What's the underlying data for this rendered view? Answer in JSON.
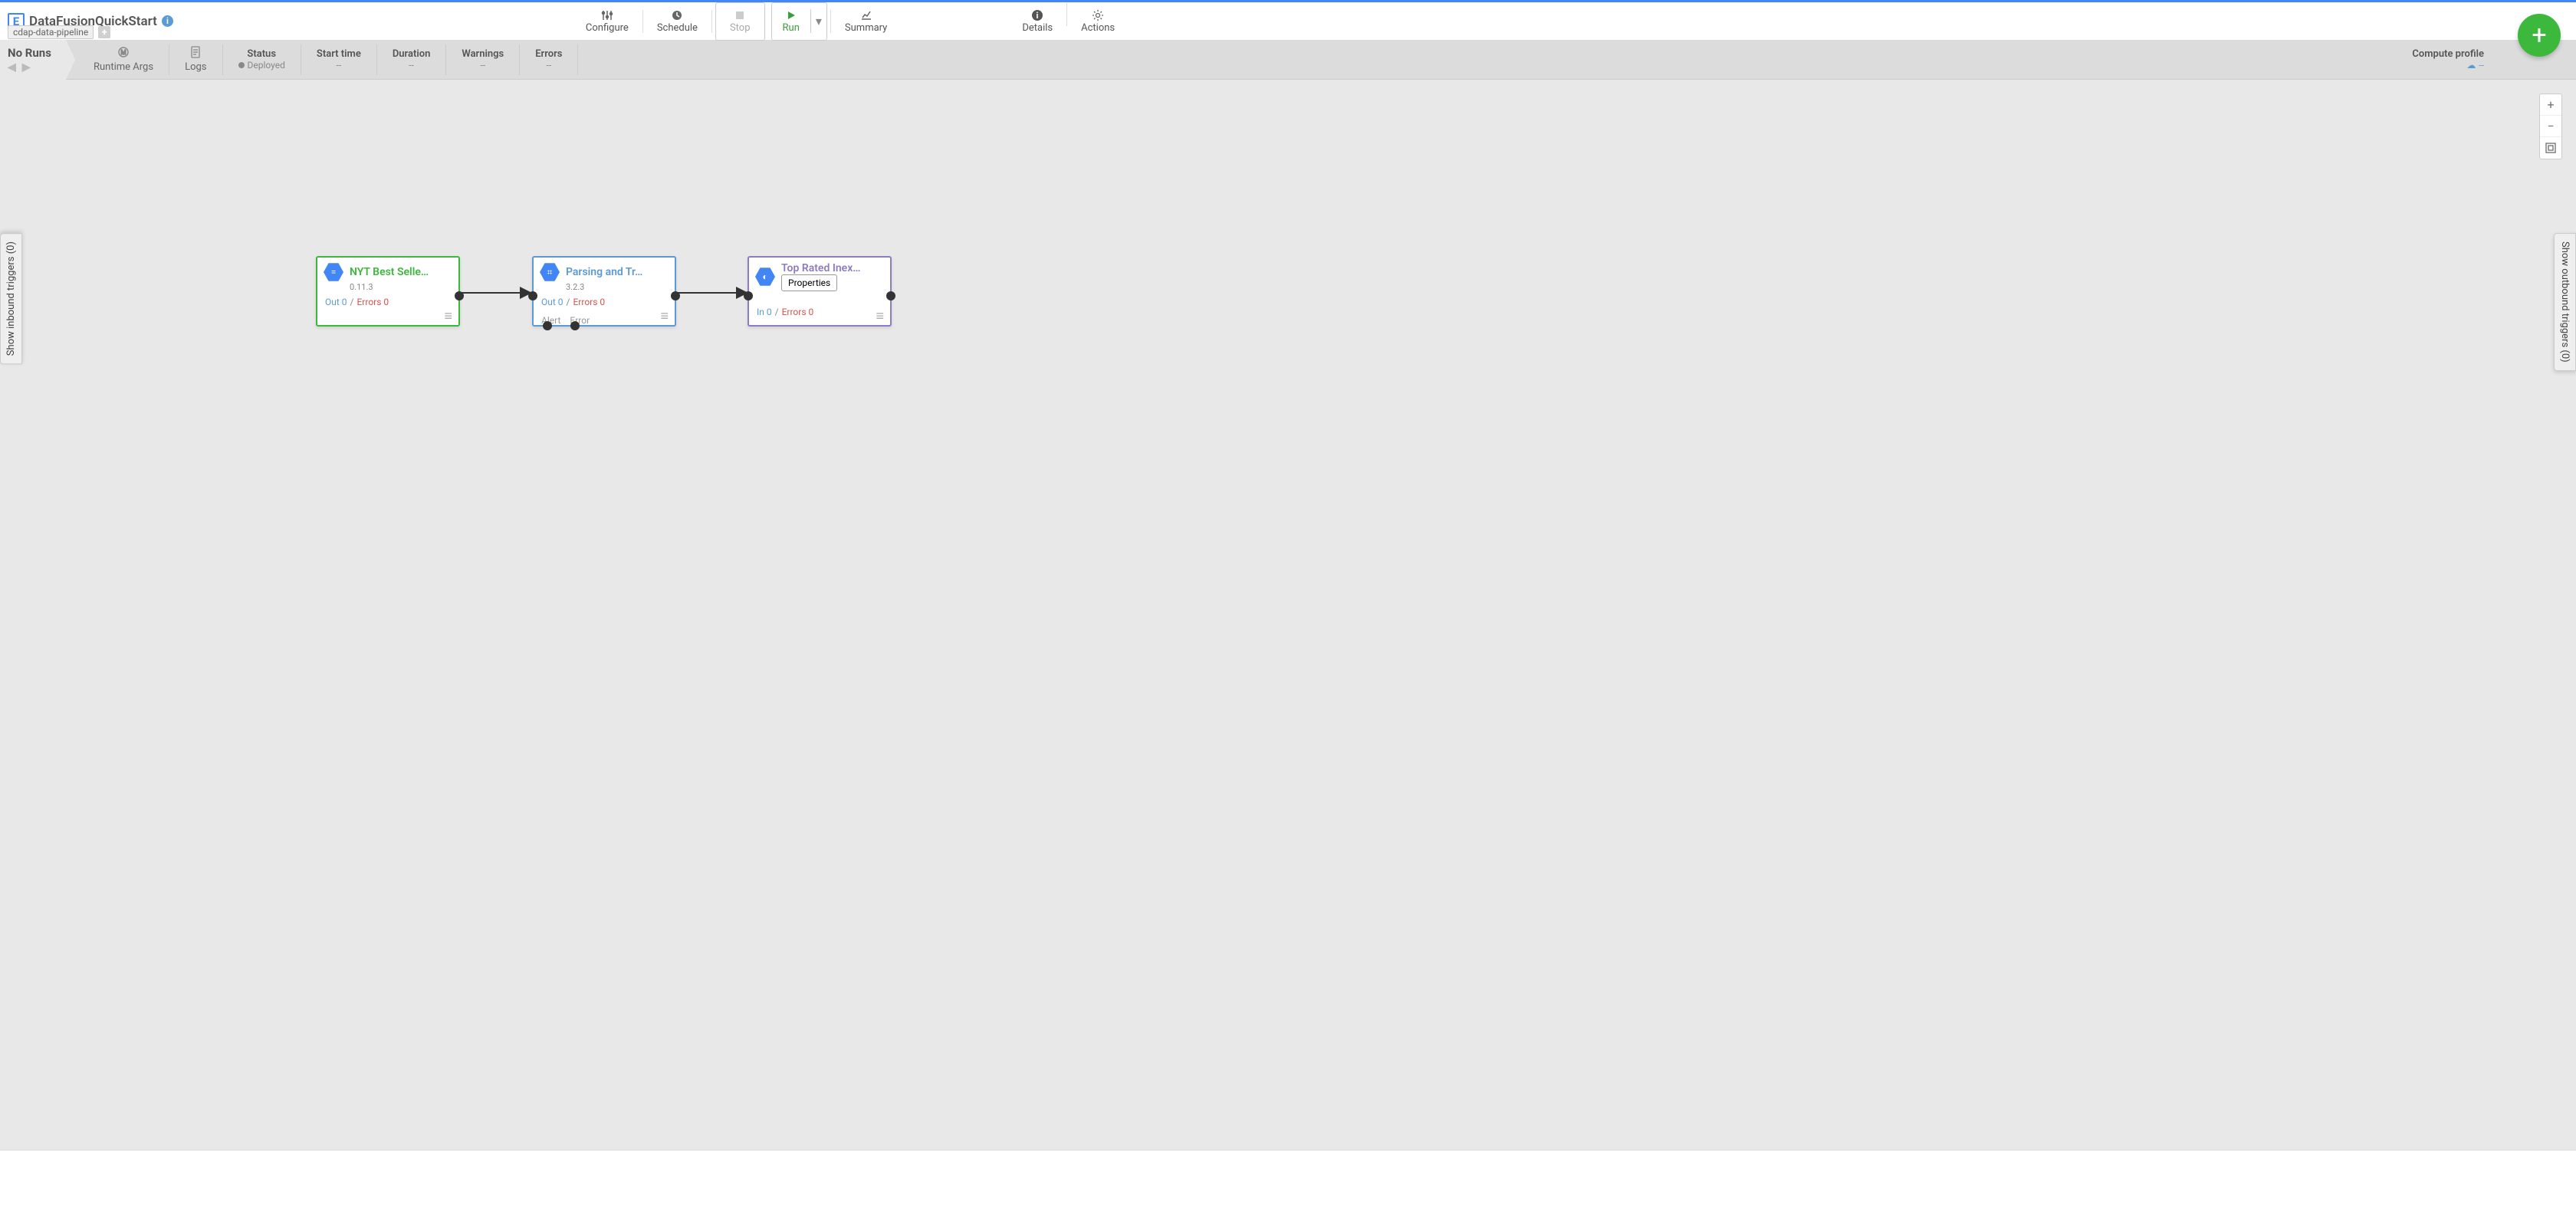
{
  "header": {
    "logo_letter": "E",
    "title": "DataFusionQuickStart",
    "pipeline_tag": "cdap-data-pipeline"
  },
  "toolbar": {
    "configure": "Configure",
    "schedule": "Schedule",
    "stop": "Stop",
    "run": "Run",
    "summary": "Summary",
    "details": "Details",
    "actions": "Actions"
  },
  "runs": {
    "no_runs": "No Runs",
    "runtime_args": "Runtime Args",
    "logs": "Logs"
  },
  "status": {
    "status_label": "Status",
    "status_value": "Deployed",
    "start_label": "Start time",
    "start_value": "--",
    "duration_label": "Duration",
    "duration_value": "--",
    "warnings_label": "Warnings",
    "warnings_value": "--",
    "errors_label": "Errors",
    "errors_value": "--",
    "compute_label": "Compute profile",
    "compute_value": "--"
  },
  "side_tabs": {
    "inbound": "Show inbound triggers (0)",
    "outbound": "Show outbound triggers (0)"
  },
  "nodes": {
    "n1": {
      "title": "NYT Best Selle…",
      "version": "0.11.3",
      "out": "Out 0",
      "err": "Errors 0"
    },
    "n2": {
      "title": "Parsing and Tr…",
      "version": "3.2.3",
      "out": "Out 0",
      "err": "Errors 0",
      "alert": "Alert",
      "error": "Error"
    },
    "n3": {
      "title": "Top Rated Inex…",
      "props": "Properties",
      "in": "In 0",
      "err": "Errors 0"
    }
  },
  "zoom": {
    "plus": "+",
    "minus": "−"
  }
}
